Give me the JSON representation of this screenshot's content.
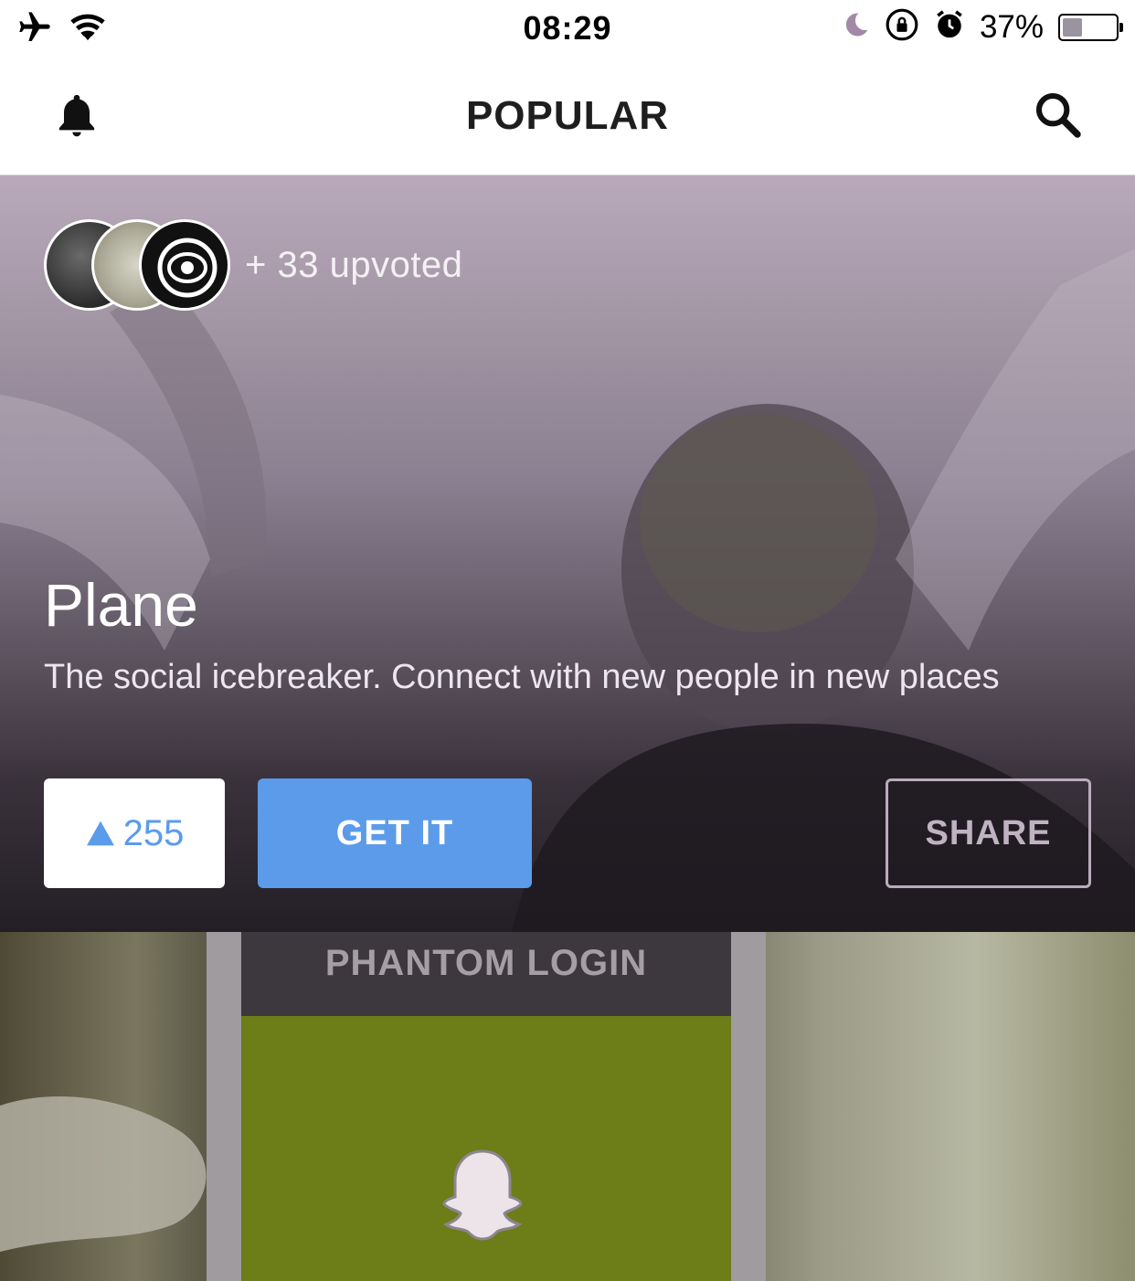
{
  "status_bar": {
    "time": "08:29",
    "battery_percent": "37%",
    "battery_level": 0.37
  },
  "nav": {
    "title": "POPULAR"
  },
  "feed": {
    "card_1": {
      "upvoted_text": "+ 33 upvoted",
      "name": "Plane",
      "tagline": "The social icebreaker. Connect with new people in new places",
      "upvote_count": "255",
      "get_label": "GET IT",
      "share_label": "SHARE"
    },
    "card_2": {
      "header_text": "PHANTOM LOGIN"
    }
  },
  "colors": {
    "accent": "#5b9bea",
    "card_overlay": "#3a323b"
  }
}
